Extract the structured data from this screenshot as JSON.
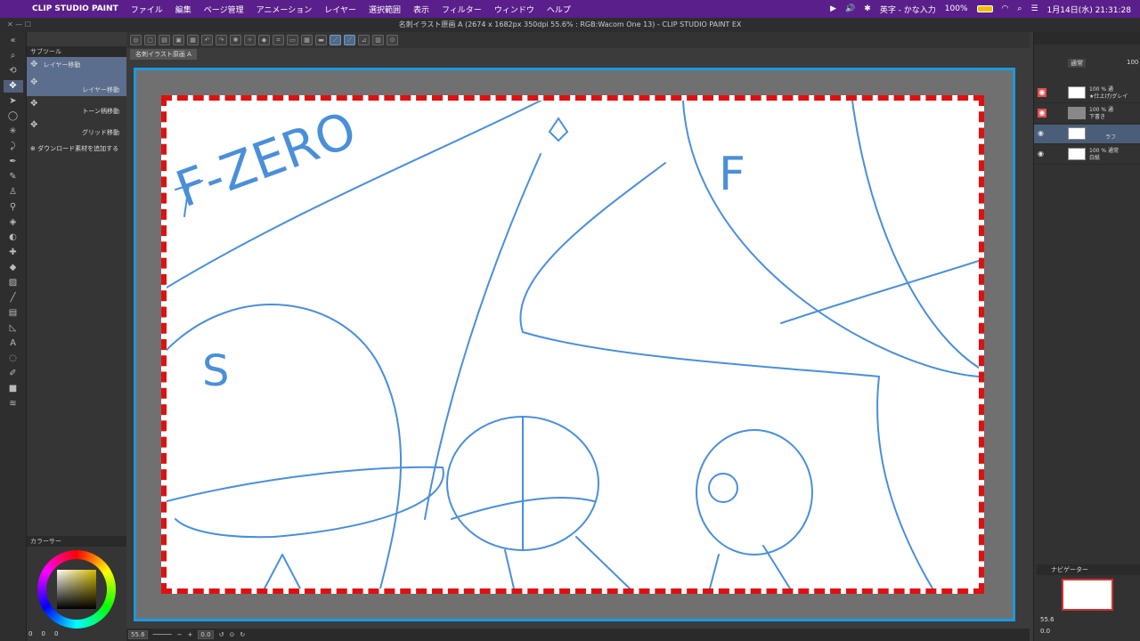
{
  "menubar": {
    "app_name": "CLIP STUDIO PAINT",
    "items": [
      "ファイル",
      "編集",
      "ページ管理",
      "アニメーション",
      "レイヤー",
      "選択範囲",
      "表示",
      "フィルター",
      "ウィンドウ",
      "ヘルプ"
    ],
    "input_mode": "英字 - かな入力",
    "battery": "100%",
    "clock": "1月14日(水) 21:31:28"
  },
  "titlebar": {
    "title": "名刺イラスト原画 A (2674 x 1682px 350dpi 55.6% : RGB:Wacom One 13)  - CLIP STUDIO PAINT EX"
  },
  "document_tab": "名刺イラスト原画 A",
  "subtool": {
    "header": "サブツール",
    "items": [
      {
        "label": "レイヤー移動"
      },
      {
        "label": "レイヤー移動"
      },
      {
        "label": "トーン柄移動"
      },
      {
        "label": "グリッド移動"
      }
    ],
    "add_material": "ダウンロード素材を追加する"
  },
  "color_panel": {
    "header": "カラーサー",
    "values": [
      "0",
      "0",
      "0"
    ]
  },
  "status": {
    "zoom": "55.6",
    "rotation": "0.0"
  },
  "layers": {
    "blend_mode": "通常",
    "opacity": "100",
    "items": [
      {
        "line1": "100 % 通",
        "line2": "★仕上げ/グレイ"
      },
      {
        "line1": "100 % 通",
        "line2": "下書き"
      },
      {
        "line1": "",
        "line2": "ラフ"
      },
      {
        "line1": "100 % 通常",
        "line2": "白紙"
      }
    ]
  },
  "navigator": {
    "header": "ナビゲーター",
    "zoom": "55.6",
    "rotation": "0.0"
  },
  "sketch_text": {
    "title_word": "F-ZERO",
    "letter_s": "S",
    "letter_f": "F"
  },
  "colors": {
    "menubar_bg": "#5a1f8a",
    "canvas_frame": "#1a9ae0",
    "safe_border": "#e01010",
    "sketch_stroke": "#4a8fd9",
    "layer_visible_red": "#e05050"
  }
}
